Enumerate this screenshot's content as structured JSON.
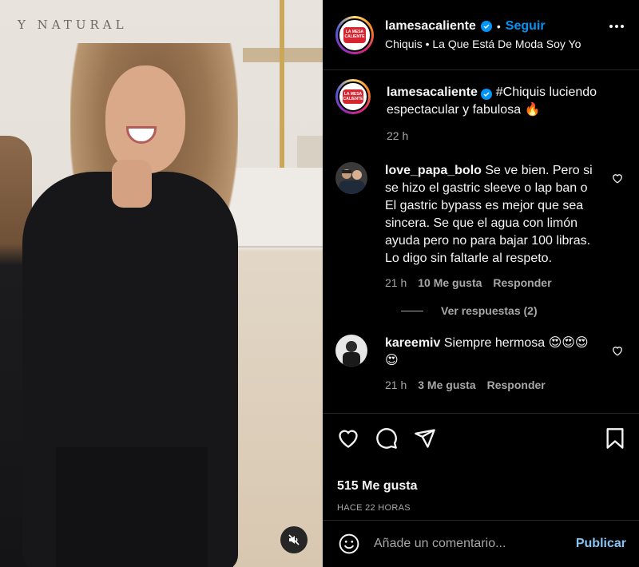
{
  "media": {
    "wall_sign": "Y NATURAL",
    "mute_icon": "speaker-muted-icon"
  },
  "header": {
    "username": "lamesacaliente",
    "separator": "•",
    "follow_label": "Seguir",
    "subtitle": "Chiquis • La Que Está De Moda Soy Yo",
    "more_icon": "more-options-icon",
    "avatar_logo": "LA MESA CALIENTE"
  },
  "caption": {
    "username": "lamesacaliente",
    "text": "#Chiquis luciendo espectacular y fabulosa 🔥",
    "time": "22 h"
  },
  "comments": [
    {
      "username": "love_papa_bolo",
      "text": "Se ve bien. Pero si se hizo el gastric sleeve o lap ban o El gastric bypass es mejor que sea sincera. Se que el agua con limón ayuda pero no para bajar 100 libras. Lo digo sin faltarle al respeto.",
      "time": "21 h",
      "likes": "10 Me gusta",
      "reply": "Responder",
      "view_replies": "Ver respuestas (2)"
    },
    {
      "username": "kareemiv",
      "text": "Siempre hermosa 😍😍😍😍",
      "time": "21 h",
      "likes": "3 Me gusta",
      "reply": "Responder"
    }
  ],
  "actions": {
    "like_icon": "heart-icon",
    "comment_icon": "comment-icon",
    "share_icon": "share-icon",
    "save_icon": "bookmark-icon",
    "likes_count": "515 Me gusta",
    "posted_ago": "HACE 22 HORAS"
  },
  "add_comment": {
    "emoji_icon": "emoji-icon",
    "placeholder": "Añade un comentario...",
    "post_label": "Publicar"
  },
  "colors": {
    "accent": "#0095f6",
    "background": "#000000",
    "muted_text": "#a8a8a8",
    "divider": "#262626"
  }
}
